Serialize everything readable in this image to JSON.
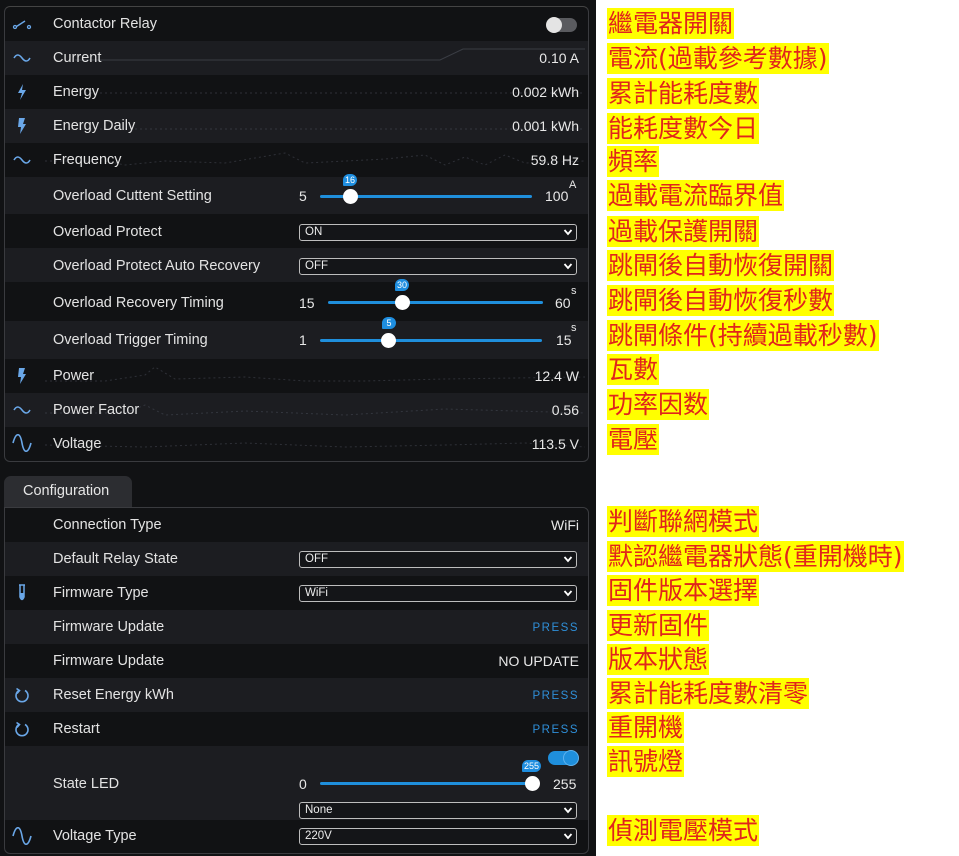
{
  "status_panel": {
    "contactor_relay": {
      "label": "Contactor Relay",
      "state": "off"
    },
    "current": {
      "label": "Current",
      "value": "0.10 A"
    },
    "energy": {
      "label": "Energy",
      "value": "0.002 kWh"
    },
    "energy_daily": {
      "label": "Energy Daily",
      "value": "0.001 kWh"
    },
    "frequency": {
      "label": "Frequency",
      "value": "59.8 Hz"
    },
    "overload_current_setting": {
      "label": "Overload Cuttent Setting",
      "min": "5",
      "max": "100",
      "unit": "A",
      "value": "16"
    },
    "overload_protect": {
      "label": "Overload Protect",
      "selected": "ON"
    },
    "overload_auto_recovery": {
      "label": "Overload Protect Auto Recovery",
      "selected": "OFF"
    },
    "overload_recovery_timing": {
      "label": "Overload Recovery Timing",
      "min": "15",
      "max": "60",
      "unit": "s",
      "value": "30"
    },
    "overload_trigger_timing": {
      "label": "Overload Trigger Timing",
      "min": "1",
      "max": "15",
      "unit": "s",
      "value": "5"
    },
    "power": {
      "label": "Power",
      "value": "12.4 W"
    },
    "power_factor": {
      "label": "Power Factor",
      "value": "0.56"
    },
    "voltage": {
      "label": "Voltage",
      "value": "113.5 V"
    }
  },
  "config_panel": {
    "tab_label": "Configuration",
    "connection_type": {
      "label": "Connection Type",
      "value": "WiFi"
    },
    "default_relay_state": {
      "label": "Default Relay State",
      "selected": "OFF"
    },
    "firmware_type": {
      "label": "Firmware Type",
      "selected": "WiFi"
    },
    "firmware_update_action": {
      "label": "Firmware Update",
      "button": "PRESS"
    },
    "firmware_update_status": {
      "label": "Firmware Update",
      "value": "NO UPDATE"
    },
    "reset_energy": {
      "label": "Reset Energy kWh",
      "button": "PRESS"
    },
    "restart": {
      "label": "Restart",
      "button": "PRESS"
    },
    "state_led": {
      "label": "State LED",
      "min": "0",
      "max": "255",
      "value": "255",
      "state": "on",
      "effect_selected": "None"
    },
    "voltage_type": {
      "label": "Voltage Type",
      "selected": "220V"
    }
  },
  "annotations": {
    "contactor_relay": "繼電器開關",
    "current": "電流(過載參考數據)",
    "energy": "累計能耗度數",
    "energy_daily": "能耗度數今日",
    "frequency": "頻率",
    "overload_current_setting": "過載電流臨界值",
    "overload_protect": "過載保護開關",
    "overload_auto_recovery": "跳閘後自動恢復開關",
    "overload_recovery_timing": "跳閘後自動恢復秒數",
    "overload_trigger_timing": "跳閘條件(持續過載秒數)",
    "power": "瓦數",
    "power_factor": "功率因数",
    "voltage": "電壓",
    "connection_type": "判斷聯網模式",
    "default_relay_state": "默認繼電器狀態(重開機時)",
    "firmware_type": "固件版本選擇",
    "firmware_update_action": "更新固件",
    "firmware_update_status": "版本狀態",
    "reset_energy": "累計能耗度數清零",
    "restart": "重開機",
    "state_led": "訊號燈",
    "voltage_type": "偵測電壓模式"
  },
  "colors": {
    "accent": "#1f8fdc",
    "panel_bg": "#111214",
    "row_alt_bg": "#1c1d21",
    "annotation_text": "#e1251b",
    "annotation_highlight": "#ffff00"
  },
  "icons": {
    "contactor_relay": "switch-icon",
    "current": "sine-wave-icon",
    "energy": "lightning-icon",
    "energy_daily": "lightning-icon",
    "frequency": "sine-wave-icon",
    "power": "lightning-icon",
    "power_factor": "sine-wave-icon",
    "voltage": "sine-wave-icon",
    "firmware_type": "test-tube-icon",
    "reset_energy": "restart-icon",
    "restart": "restart-icon",
    "voltage_type": "sine-wave-icon"
  }
}
